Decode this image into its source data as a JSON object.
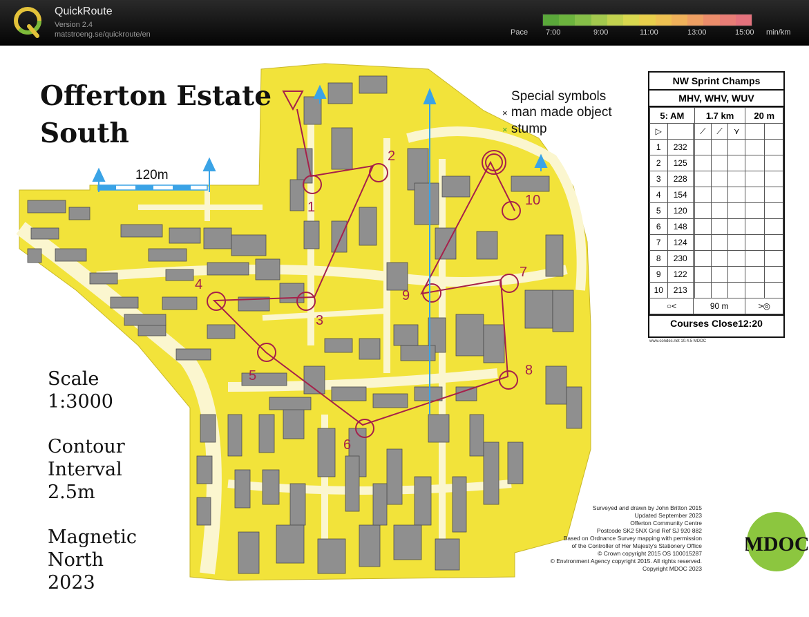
{
  "app": {
    "name": "QuickRoute",
    "version": "Version 2.4",
    "url": "matstroeng.se/quickroute/en"
  },
  "pace_legend": {
    "label": "Pace",
    "ticks": [
      "7:00",
      "9:00",
      "11:00",
      "13:00",
      "15:00"
    ],
    "unit": "min/km",
    "colors": [
      "#5aa83a",
      "#6cb43e",
      "#86bf48",
      "#a3c94e",
      "#c2d24f",
      "#d9d84f",
      "#e8cf4c",
      "#eec152",
      "#efb15a",
      "#ee9f63",
      "#ec8d6b",
      "#e87d76",
      "#e4727d"
    ]
  },
  "map": {
    "title_line1": "Offerton Estate",
    "title_line2": "South",
    "scale_label": "Scale",
    "scale_value": "1:3000",
    "contour_line1": "Contour",
    "contour_line2": "Interval",
    "contour_value": "2.5m",
    "magnetic_line1": "Magnetic",
    "magnetic_line2": "North",
    "magnetic_value": "2023",
    "scale_bar_label": "120m",
    "special_symbols_title": "Special symbols",
    "special_symbol_1": "man made object",
    "special_symbol_2": "stump",
    "control_numbers": [
      "1",
      "2",
      "3",
      "4",
      "5",
      "6",
      "7",
      "8",
      "9",
      "10"
    ],
    "colors": {
      "yellow": "#f2e33a",
      "pale_yellow": "#f8f0a0",
      "building": "#8f8f8f",
      "course": "#a6204a",
      "north_arrow": "#3aa3e6"
    }
  },
  "control_card": {
    "event": "NW Sprint Champs",
    "classes": "MHV, WHV, WUV",
    "course": "5: AM",
    "length": "1.7 km",
    "climb": "20 m",
    "rows": [
      {
        "n": "1",
        "code": "232"
      },
      {
        "n": "2",
        "code": "125"
      },
      {
        "n": "3",
        "code": "228"
      },
      {
        "n": "4",
        "code": "154"
      },
      {
        "n": "5",
        "code": "120"
      },
      {
        "n": "6",
        "code": "148"
      },
      {
        "n": "7",
        "code": "124"
      },
      {
        "n": "8",
        "code": "230"
      },
      {
        "n": "9",
        "code": "122"
      },
      {
        "n": "10",
        "code": "213"
      }
    ],
    "finish_distance": "90 m",
    "close_text": "Courses Close12:20",
    "footer": "www.condes.net 10.4.5 MDOC"
  },
  "credits": [
    "Surveyed and drawn by John Britton 2015",
    "Updated September 2023",
    "Offerton Community Centre",
    "Postcode SK2 5NX   Grid Ref SJ 920 882",
    "Based on Ordnance Survey mapping with permission",
    "of the Controller of Her Majesty's Stationery Office",
    "© Crown copyright 2015 OS 100015287",
    "© Environment Agency copyright 2015. All rights reserved.",
    "Copyright MDOC 2023"
  ],
  "club_logo_text": "MDOC"
}
